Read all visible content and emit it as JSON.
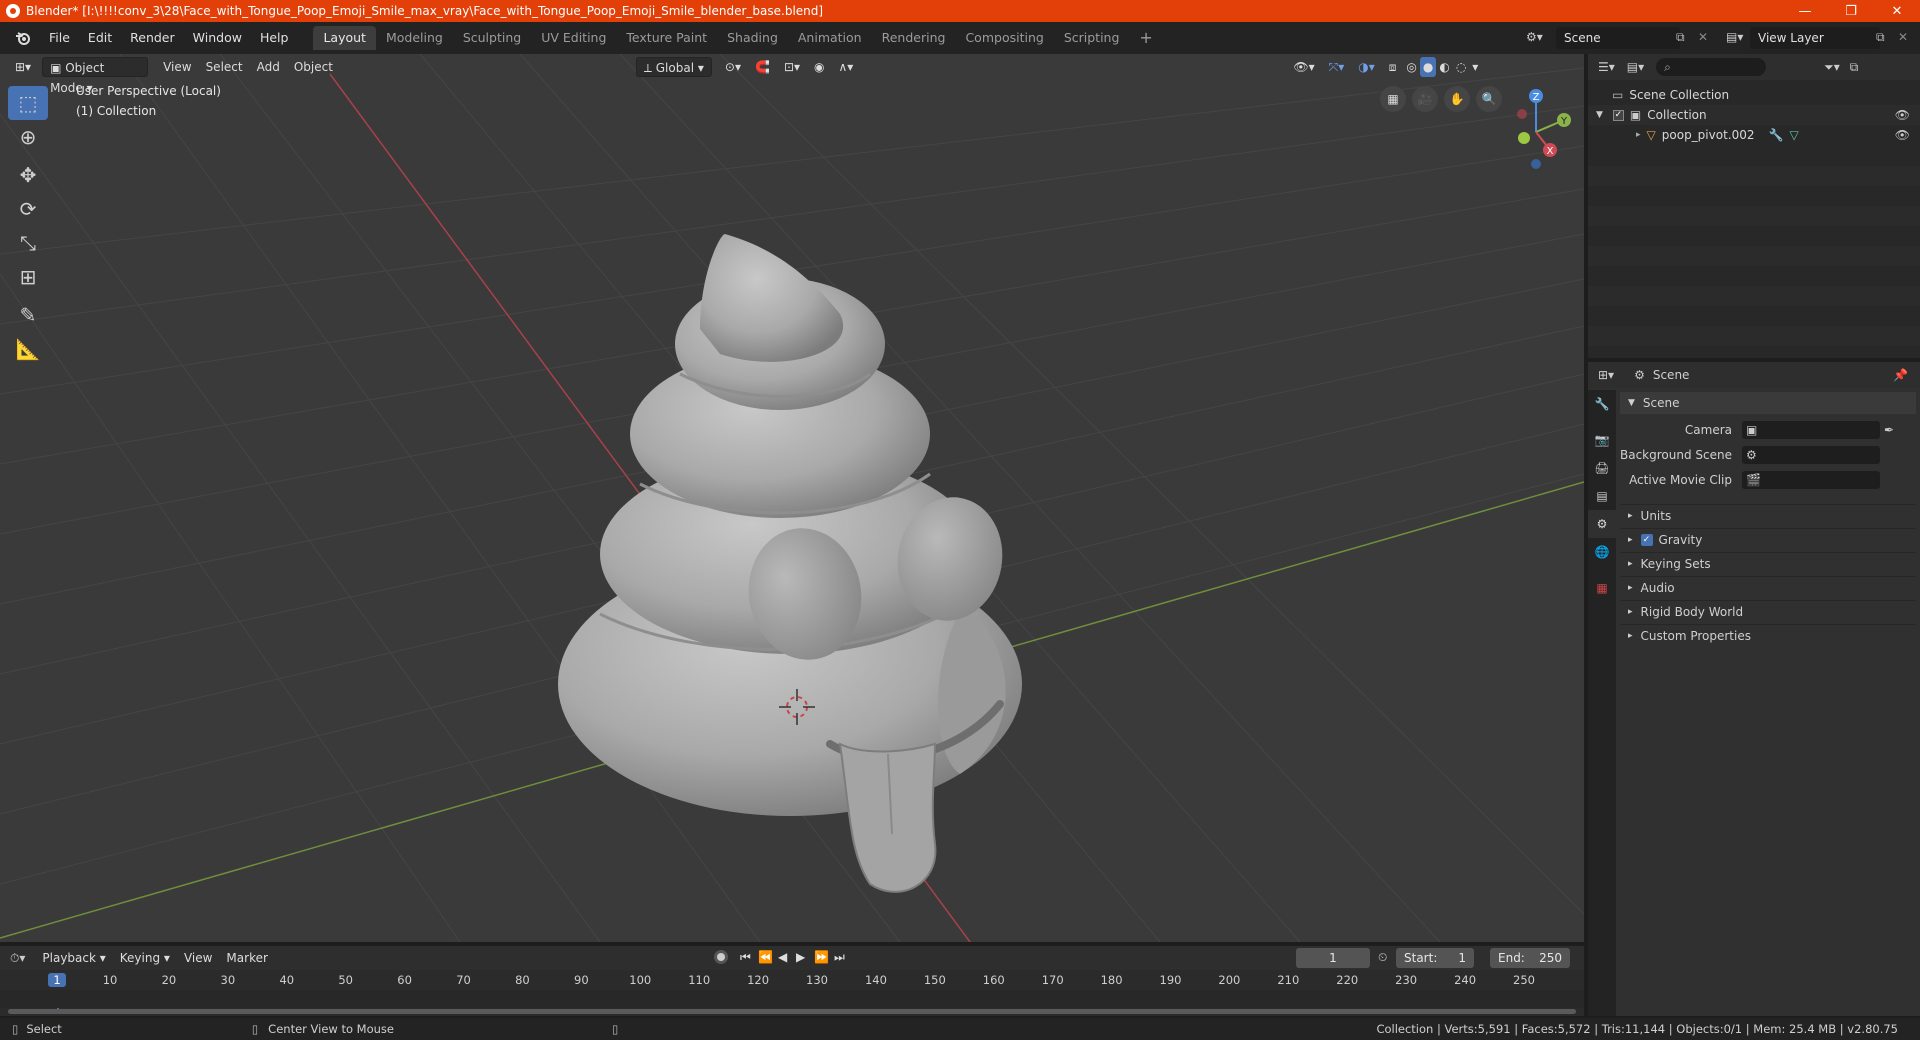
{
  "window": {
    "title": "Blender* [I:\\!!!!conv_3\\28\\Face_with_Tongue_Poop_Emoji_Smile_max_vray\\Face_with_Tongue_Poop_Emoji_Smile_blender_base.blend]",
    "minimize": "—",
    "maximize": "❐",
    "close": "✕"
  },
  "menu": [
    "File",
    "Edit",
    "Render",
    "Window",
    "Help"
  ],
  "workspaces": [
    "Layout",
    "Modeling",
    "Sculpting",
    "UV Editing",
    "Texture Paint",
    "Shading",
    "Animation",
    "Rendering",
    "Compositing",
    "Scripting"
  ],
  "active_workspace": "Layout",
  "scene_name": "Scene",
  "view_layer": "View Layer",
  "viewport": {
    "mode": "Object Mode",
    "menus": [
      "View",
      "Select",
      "Add",
      "Object"
    ],
    "orientation": "Global",
    "perspective_label": "User Perspective (Local)",
    "collection_label": "(1) Collection",
    "gizmo": {
      "x": "X",
      "y": "Y",
      "z": "Z"
    }
  },
  "outliner": {
    "root": "Scene Collection",
    "collection": "Collection",
    "object": "poop_pivot.002"
  },
  "properties": {
    "header": "Scene",
    "section": "Scene",
    "fields": [
      {
        "label": "Camera",
        "value": ""
      },
      {
        "label": "Background Scene",
        "value": ""
      },
      {
        "label": "Active Movie Clip",
        "value": ""
      }
    ],
    "subpanels": [
      "Units",
      "Gravity",
      "Keying Sets",
      "Audio",
      "Rigid Body World",
      "Custom Properties"
    ],
    "gravity_checked": true
  },
  "timeline": {
    "menus": [
      "Playback",
      "Keying",
      "View",
      "Marker"
    ],
    "current_frame": "1",
    "start_label": "Start:",
    "start": "1",
    "end_label": "End:",
    "end": "250",
    "ticks": [
      "1",
      "10",
      "20",
      "30",
      "40",
      "50",
      "60",
      "70",
      "80",
      "90",
      "100",
      "110",
      "120",
      "130",
      "140",
      "150",
      "160",
      "170",
      "180",
      "190",
      "200",
      "210",
      "220",
      "230",
      "240",
      "250"
    ]
  },
  "status": {
    "left_action": "Select",
    "middle_action": "Center View to Mouse",
    "stats": "Collection | Verts:5,591 | Faces:5,572 | Tris:11,144 | Objects:0/1 | Mem: 25.4 MB | v2.80.75"
  },
  "colors": {
    "title_bar": "#e34009",
    "accent": "#4772b3",
    "viewport_bg": "#3a3a3a",
    "x_axis": "#cf4a55",
    "y_axis": "#8ab44a",
    "z_axis": "#4a8de0"
  }
}
